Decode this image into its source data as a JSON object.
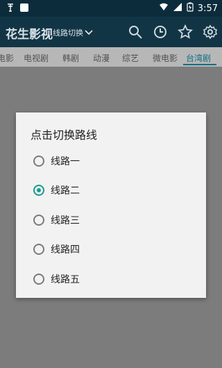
{
  "status": {
    "left_icons": [
      "usb-debug-icon",
      "notification-square-icon"
    ],
    "right_icons": [
      "wifi-icon",
      "signal-icon",
      "battery-icon"
    ],
    "time": "3:57"
  },
  "appbar": {
    "title": "花生影视",
    "switch_label": "线路切换",
    "icons": [
      "search-icon",
      "history-icon",
      "star-icon",
      "settings-icon"
    ]
  },
  "tabs": {
    "items": [
      "电影",
      "电视剧",
      "韩剧",
      "动漫",
      "综艺",
      "微电影",
      "台湾剧"
    ],
    "active": "台湾剧"
  },
  "dialog": {
    "title": "点击切换路线",
    "options": [
      "线路一",
      "线路二",
      "线路三",
      "线路四",
      "线路五"
    ],
    "selected": "线路二"
  },
  "colors": {
    "statusbar": "#0c2c3b",
    "appbar": "#123546",
    "accent": "#159b8f",
    "overlay": "#7c7c7c"
  }
}
